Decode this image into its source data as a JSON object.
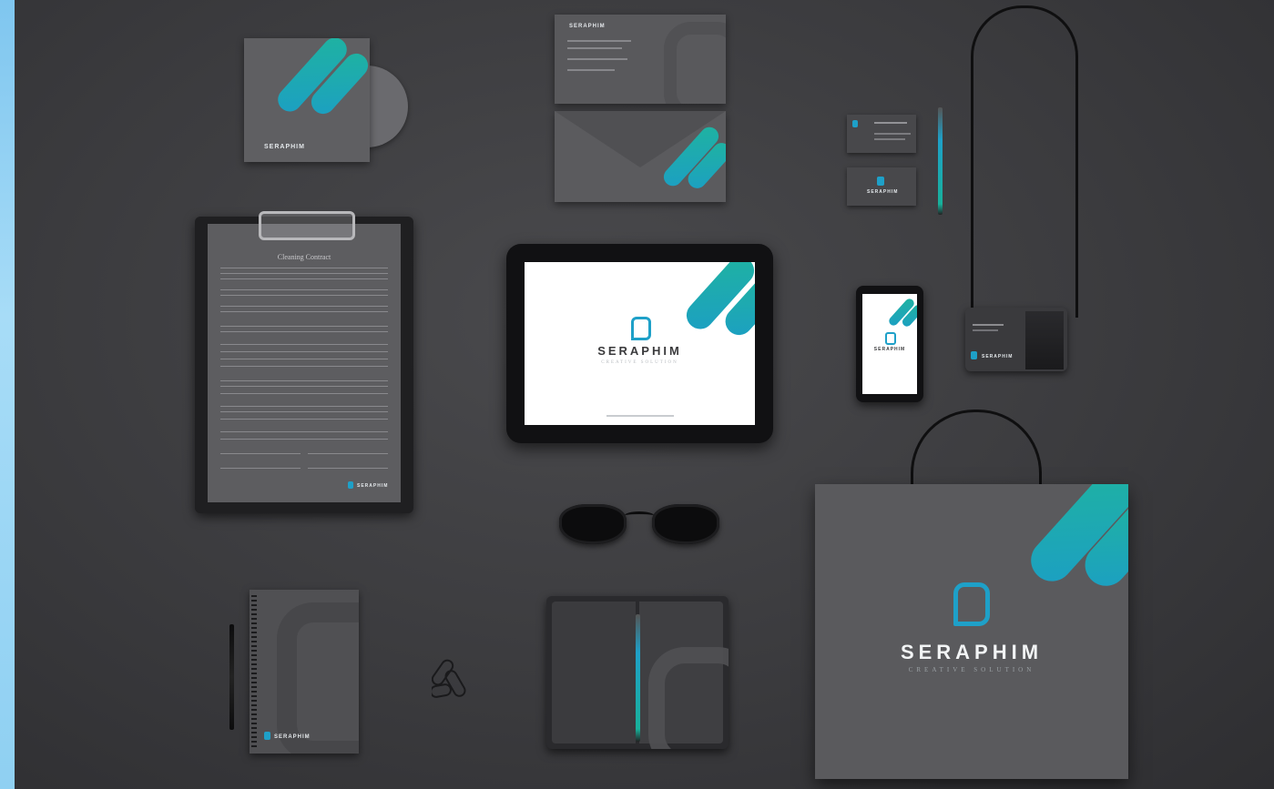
{
  "brand": {
    "name": "SERAPHIM",
    "tagline": "CREATIVE SOLUTION",
    "colors": {
      "teal": "#1fb3a0",
      "blue": "#1c9fc3",
      "dark": "#3a3a3c"
    }
  },
  "contract": {
    "title": "Cleaning Contract"
  },
  "scene": {
    "items": [
      "cd-sleeve",
      "letterhead-envelope",
      "envelope",
      "business-cards",
      "pen",
      "clipboard-contract",
      "tablet",
      "smartphone",
      "id-badge",
      "sunglasses",
      "paper-clips",
      "spiral-notebook",
      "open-notebook",
      "shopping-bag"
    ]
  }
}
